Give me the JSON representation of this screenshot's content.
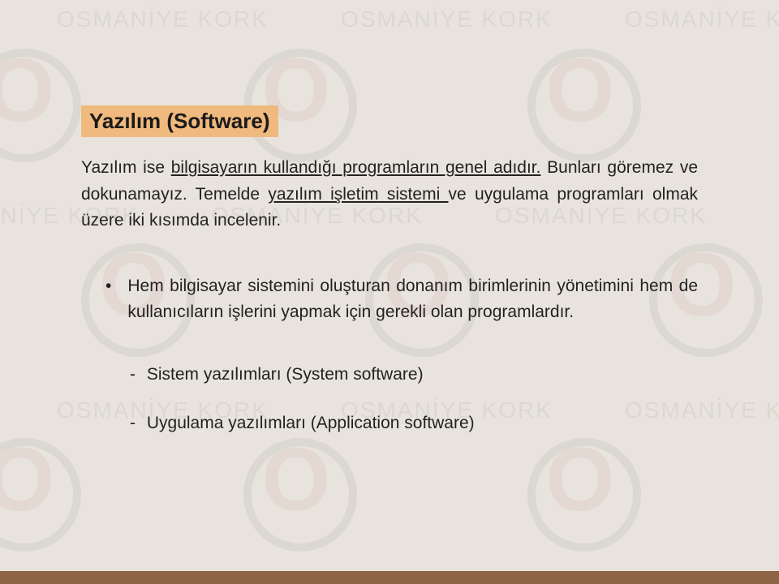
{
  "title": "Yazılım (Software)",
  "paragraph": {
    "t1": "Yazılım ise ",
    "u1": "bilgisayarın kullandığı programların genel adıdır.",
    "t2": " Bunları göremez ve dokunamayız. Temelde ",
    "u2": "yazılım işletim sistemi ",
    "t3": "ve uygulama programları olmak üzere iki kısımda incelenir."
  },
  "bullet": "Hem bilgisayar sistemini oluşturan donanım birimlerinin yönetimini hem de kullanıcıların işlerini yapmak için gerekli olan programlardır.",
  "sub1": "Sistem yazılımları (System software)",
  "sub2": "Uygulama yazılımları (Application software)",
  "watermark": "OSMANİYE KORK"
}
